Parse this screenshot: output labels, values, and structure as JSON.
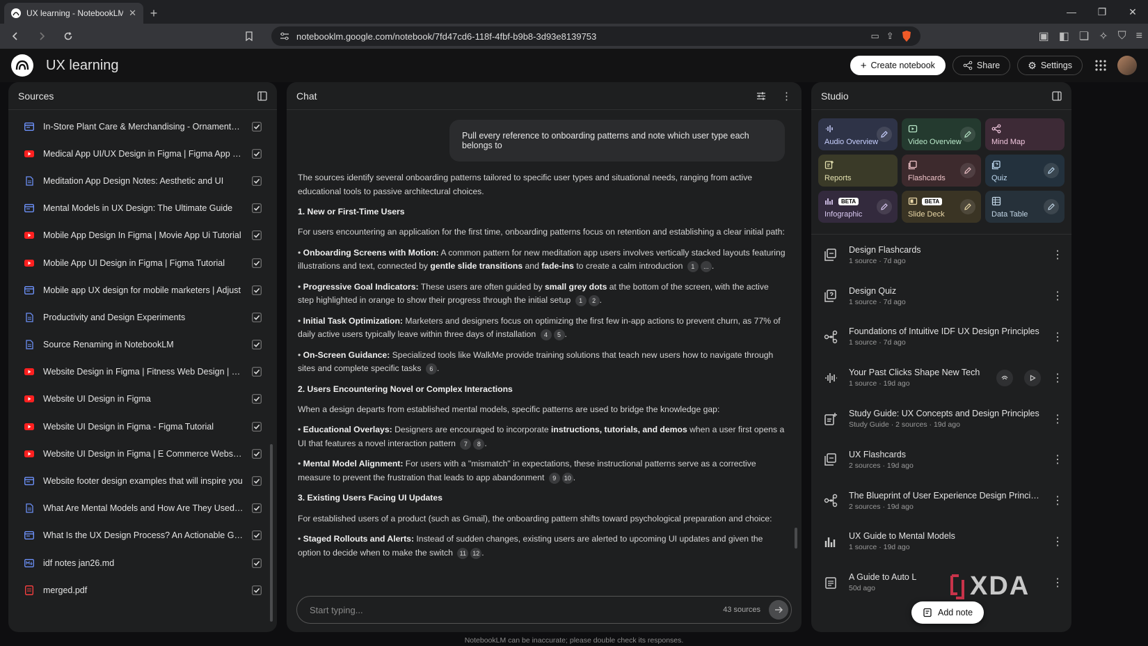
{
  "browser": {
    "tab_title": "UX learning - NotebookLM",
    "url": "notebooklm.google.com/notebook/7fd47cd6-118f-4fbf-b9b8-3d93e8139753"
  },
  "header": {
    "title": "UX learning",
    "create_label": "Create notebook",
    "share_label": "Share",
    "settings_label": "Settings"
  },
  "sources": {
    "title": "Sources",
    "items": [
      {
        "label": "In-Store Plant Care & Merchandising - Ornamental Pr...",
        "type": "web"
      },
      {
        "label": "Medical App UI/UX Design in Figma | Figma App Desi...",
        "type": "youtube"
      },
      {
        "label": "Meditation App Design Notes: Aesthetic and UI",
        "type": "doc"
      },
      {
        "label": "Mental Models in UX Design: The Ultimate Guide",
        "type": "web"
      },
      {
        "label": "Mobile App Design In Figma | Movie App Ui Tutorial",
        "type": "youtube"
      },
      {
        "label": "Mobile App UI Design in Figma | Figma Tutorial",
        "type": "youtube"
      },
      {
        "label": "Mobile app UX design for mobile marketers | Adjust",
        "type": "web"
      },
      {
        "label": "Productivity and Design Experiments",
        "type": "doc"
      },
      {
        "label": "Source Renaming in NotebookLM",
        "type": "doc"
      },
      {
        "label": "Website Design in Figma | Fitness Web Design | Figm...",
        "type": "youtube"
      },
      {
        "label": "Website UI Design in Figma",
        "type": "youtube"
      },
      {
        "label": "Website UI Design in Figma - Figma Tutorial",
        "type": "youtube"
      },
      {
        "label": "Website UI Design in Figma | E Commerce Website D...",
        "type": "youtube"
      },
      {
        "label": "Website footer design examples that will inspire you",
        "type": "web"
      },
      {
        "label": "What Are Mental Models and How Are They Used in ...",
        "type": "doc"
      },
      {
        "label": "What Is the UX Design Process? An Actionable Guide...",
        "type": "web"
      },
      {
        "label": "idf notes jan26.md",
        "type": "md"
      },
      {
        "label": "merged.pdf",
        "type": "pdf"
      }
    ]
  },
  "chat": {
    "title": "Chat",
    "user_message": "Pull every reference to onboarding patterns and note which user type each belongs to",
    "intro": "The sources identify several onboarding patterns tailored to specific user types and situational needs, ranging from active educational tools to passive architectural choices.",
    "h1": "1. New or First-Time Users",
    "h1_intro": "For users encountering an application for the first time, onboarding patterns focus on retention and establishing a clear initial path:",
    "b1_title": "Onboarding Screens with Motion:",
    "b1_a": " A common pattern for new meditation app users involves vertically stacked layouts featuring illustrations and text, connected by ",
    "b1_k1": "gentle slide transitions",
    "b1_b": " and ",
    "b1_k2": "fade-ins",
    "b1_c": " to create a calm introduction",
    "b1_cites": [
      "1",
      "..."
    ],
    "b2_title": "Progressive Goal Indicators:",
    "b2_a": " These users are often guided by ",
    "b2_k1": "small grey dots",
    "b2_b": " at the bottom of the screen, with the active step highlighted in orange to show their progress through the initial setup",
    "b2_cites": [
      "1",
      "2"
    ],
    "b3_title": "Initial Task Optimization:",
    "b3_a": " Marketers and designers focus on optimizing the first few in-app actions to prevent churn, as 77% of daily active users typically leave within three days of installation",
    "b3_cites": [
      "4",
      "5"
    ],
    "b4_title": "On-Screen Guidance:",
    "b4_a": " Specialized tools like WalkMe provide training solutions that teach new users how to navigate through sites and complete specific tasks",
    "b4_cites": [
      "6"
    ],
    "h2": "2. Users Encountering Novel or Complex Interactions",
    "h2_intro": "When a design departs from established mental models, specific patterns are used to bridge the knowledge gap:",
    "b5_title": "Educational Overlays:",
    "b5_a": " Designers are encouraged to incorporate ",
    "b5_k1": "instructions, tutorials, and demos",
    "b5_b": " when a user first opens a UI that features a novel interaction pattern",
    "b5_cites": [
      "7",
      "8"
    ],
    "b6_title": "Mental Model Alignment:",
    "b6_a": " For users with a \"mismatch\" in expectations, these instructional patterns serve as a corrective measure to prevent the frustration that leads to app abandonment",
    "b6_cites": [
      "9",
      "10"
    ],
    "h3": "3. Existing Users Facing UI Updates",
    "h3_intro": "For established users of a product (such as Gmail), the onboarding pattern shifts toward psychological preparation and choice:",
    "b7_title": "Staged Rollouts and Alerts:",
    "b7_a": " Instead of sudden changes, existing users are alerted to upcoming UI updates and given the option to decide when to make the switch",
    "b7_cites": [
      "11",
      "12"
    ],
    "input_placeholder": "Start typing...",
    "source_count": "43 sources"
  },
  "studio": {
    "title": "Studio",
    "tiles": [
      {
        "label": "Audio Overview",
        "bg": "#2e3347",
        "fg": "#c8d0ff",
        "edit": true,
        "beta": false
      },
      {
        "label": "Video Overview",
        "bg": "#243a2f",
        "fg": "#b9e8c9",
        "edit": true,
        "beta": false
      },
      {
        "label": "Mind Map",
        "bg": "#3d2a36",
        "fg": "#f0c6dd",
        "edit": false,
        "beta": false
      },
      {
        "label": "Reports",
        "bg": "#3a3a28",
        "fg": "#e5e2b0",
        "edit": false,
        "beta": false
      },
      {
        "label": "Flashcards",
        "bg": "#3d2a2d",
        "fg": "#f0c4c9",
        "edit": true,
        "beta": false
      },
      {
        "label": "Quiz",
        "bg": "#23313d",
        "fg": "#bcd7ee",
        "edit": true,
        "beta": false
      },
      {
        "label": "Infographic",
        "bg": "#332a3d",
        "fg": "#d8c8f0",
        "edit": true,
        "beta": true
      },
      {
        "label": "Slide Deck",
        "bg": "#3a3424",
        "fg": "#ead8a8",
        "edit": true,
        "beta": true
      },
      {
        "label": "Data Table",
        "bg": "#26313a",
        "fg": "#c2d6e6",
        "edit": true,
        "beta": false
      }
    ],
    "beta_label": "BETA",
    "notes": [
      {
        "title": "Design Flashcards",
        "meta": "1 source · 7d ago",
        "icon": "flashcards"
      },
      {
        "title": "Design Quiz",
        "meta": "1 source · 7d ago",
        "icon": "quiz"
      },
      {
        "title": "Foundations of Intuitive IDF UX Design Principles",
        "meta": "1 source · 7d ago",
        "icon": "mindmap"
      },
      {
        "title": "Your Past Clicks Shape New Tech",
        "meta": "1 source · 19d ago",
        "icon": "audio"
      },
      {
        "title": "Study Guide: UX Concepts and Design Principles",
        "meta": "Study Guide · 2 sources · 19d ago",
        "icon": "report"
      },
      {
        "title": "UX Flashcards",
        "meta": "2 sources · 19d ago",
        "icon": "flashcards"
      },
      {
        "title": "The Blueprint of User Experience Design Principles",
        "meta": "2 sources · 19d ago",
        "icon": "mindmap"
      },
      {
        "title": "UX Guide to Mental Models",
        "meta": "1 source · 19d ago",
        "icon": "infographic"
      },
      {
        "title": "A Guide to Auto L",
        "meta": "50d ago",
        "icon": "note"
      }
    ],
    "add_note_label": "Add note",
    "watermark": "XDA"
  },
  "footer": "NotebookLM can be inaccurate; please double check its responses."
}
